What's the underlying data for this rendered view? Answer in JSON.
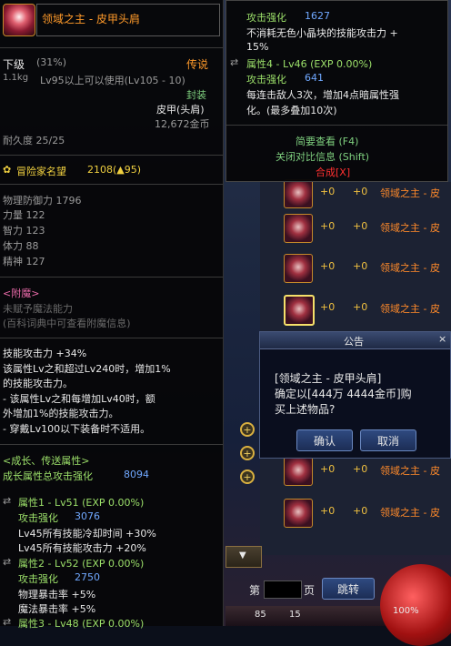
{
  "item": {
    "name": "领域之主 - 皮甲头肩",
    "grade": "下级",
    "grade_pct": "(31%)",
    "rarity": "传说",
    "weight": "1.1kg",
    "level_req": "Lv95以上可以使用(Lv105 - 10)",
    "seal": "封装",
    "type": "皮甲(头肩)",
    "price": "12,672金币",
    "durability": "耐久度 25/25",
    "adventurer_label": "冒险家名望",
    "adventurer_value": "2108(▲95)",
    "stats": [
      "物理防御力 1796",
      "力量 122",
      "智力 123",
      "体力 88",
      "精神 127"
    ],
    "enchant_title": "<附魔>",
    "enchant_lines": [
      "未赋予魔法能力",
      "(百科词典中可查看附魔信息)"
    ],
    "effects": [
      "技能攻击力 +34%",
      "该属性Lv之和超过Lv240时，增加1%",
      "的技能攻击力。",
      "- 该属性Lv之和每增加Lv40时，额",
      "外增加1%的技能攻击力。",
      "- 穿戴Lv100以下装备时不适用。"
    ],
    "growth_title": "<成长、传送属性>",
    "growth_total_label": "成长属性总攻击强化",
    "growth_total_value": "8094",
    "attr1": {
      "header": "属性1 - Lv51 (EXP 0.00%)",
      "atk_label": "攻击强化",
      "atk_value": "3076",
      "lines": [
        "Lv45所有技能冷却时间 +30%",
        "Lv45所有技能攻击力 +20%"
      ]
    },
    "attr2": {
      "header": "属性2 - Lv52 (EXP 0.00%)",
      "atk_label": "攻击强化",
      "atk_value": "2750",
      "lines": [
        "物理暴击率 +5%",
        "魔法暴击率 +5%"
      ]
    },
    "attr3": {
      "header": "属性3 - Lv48 (EXP 0.00%)"
    }
  },
  "tooltip2": {
    "atk_label": "攻击强化",
    "atk_value": "1627",
    "desc1": "不消耗无色小晶块的技能攻击力 +",
    "desc1b": "15%",
    "attr4_header": "属性4 - Lv46 (EXP 0.00%)",
    "atk2_label": "攻击强化",
    "atk2_value": "641",
    "desc2": "每连击敌人3次，增加4点暗属性强",
    "desc2b": "化。(最多叠加10次)",
    "brief": "简要查看 (F4)",
    "compare": "关闭对比信息 (Shift)",
    "synth": "合成[X]"
  },
  "list": {
    "plus_a": "+0",
    "plus_b": "+0",
    "name": "领域之主 - 皮"
  },
  "dialog": {
    "title": "公告",
    "line1": "[领域之主 - 皮甲头肩]",
    "line2": "确定以[444万 4444金币]购",
    "line3": "买上述物品?",
    "confirm": "确认",
    "cancel": "取消",
    "close": "×"
  },
  "pager": {
    "page_prefix": "第",
    "page_suffix": "页",
    "jump": "跳转"
  },
  "hud": {
    "hp_pct": "100%",
    "count1": "85",
    "count2": "15"
  },
  "colors": {
    "accent_orange": "#ff9a2a",
    "rarity_legend": "#ff3030",
    "stat_blue": "#70a8ff"
  }
}
